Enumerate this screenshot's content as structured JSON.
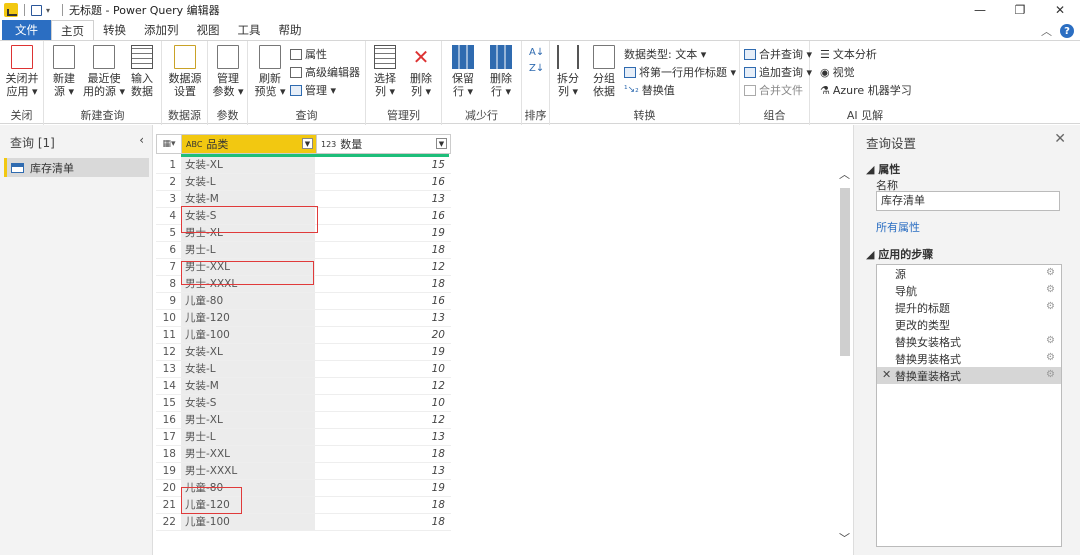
{
  "titlebar": {
    "doc_name": "无标题 - Power Query 编辑器"
  },
  "menu": {
    "tabs": [
      "文件",
      "主页",
      "转换",
      "添加列",
      "视图",
      "工具",
      "帮助"
    ]
  },
  "ribbon": {
    "close_apply": "关闭并\n应用 ▾",
    "new_source": "新建\n源 ▾",
    "recent_sources": "最近使\n用的源 ▾",
    "enter_data": "输入\n数据",
    "ds_settings": "数据源\n设置",
    "manage_params": "管理\n参数 ▾",
    "refresh_preview": "刷新\n预览 ▾",
    "properties": "属性",
    "advanced_editor": "高级编辑器",
    "manage": "管理 ▾",
    "choose_columns": "选择\n列 ▾",
    "remove_columns": "删除\n列 ▾",
    "keep_rows": "保留\n行 ▾",
    "remove_rows": "删除\n行 ▾",
    "split_column": "拆分\n列 ▾",
    "group_by": "分组\n依据",
    "data_type": "数据类型: 文本 ▾",
    "first_row_header": "将第一行用作标题 ▾",
    "replace_values": "替换值",
    "merge_queries": "合并查询 ▾",
    "append_queries": "追加查询 ▾",
    "combine_files": "合并文件",
    "text_analytics": "文本分析",
    "vision": "视觉",
    "azure_ml": "Azure 机器学习",
    "groups": [
      "关闭",
      "新建查询",
      "数据源",
      "参数",
      "查询",
      "管理列",
      "减少行",
      "排序",
      "转换",
      "组合",
      "AI 见解"
    ]
  },
  "queries_panel": {
    "header": "查询 [1]",
    "items": [
      "库存清单"
    ]
  },
  "grid": {
    "col1_header": "品类",
    "col2_header": "数量",
    "col1_type": "ABC",
    "col2_type": "123",
    "rows": [
      [
        "1",
        "女装-XL",
        "15"
      ],
      [
        "2",
        "女装-L",
        "16"
      ],
      [
        "3",
        "女装-M",
        "13"
      ],
      [
        "4",
        "女装-S",
        "16"
      ],
      [
        "5",
        "男士-XL",
        "19"
      ],
      [
        "6",
        "男士-L",
        "18"
      ],
      [
        "7",
        "男士-XXL",
        "12"
      ],
      [
        "8",
        "男士-XXXL",
        "18"
      ],
      [
        "9",
        "儿童-80",
        "16"
      ],
      [
        "10",
        "儿童-120",
        "13"
      ],
      [
        "11",
        "儿童-100",
        "20"
      ],
      [
        "12",
        "女装-XL",
        "19"
      ],
      [
        "13",
        "女装-L",
        "10"
      ],
      [
        "14",
        "女装-M",
        "12"
      ],
      [
        "15",
        "女装-S",
        "10"
      ],
      [
        "16",
        "男士-XL",
        "12"
      ],
      [
        "17",
        "男士-L",
        "13"
      ],
      [
        "18",
        "男士-XXL",
        "18"
      ],
      [
        "19",
        "男士-XXXL",
        "13"
      ],
      [
        "20",
        "儿童-80",
        "19"
      ],
      [
        "21",
        "儿童-120",
        "18"
      ],
      [
        "22",
        "儿童-100",
        "18"
      ]
    ]
  },
  "settings": {
    "title": "查询设置",
    "properties_label": "属性",
    "name_label": "名称",
    "name_value": "库存清单",
    "all_props": "所有属性",
    "steps_label": "应用的步骤",
    "steps": [
      "源",
      "导航",
      "提升的标题",
      "更改的类型",
      "替换女装格式",
      "替换男装格式",
      "替换童装格式"
    ]
  }
}
